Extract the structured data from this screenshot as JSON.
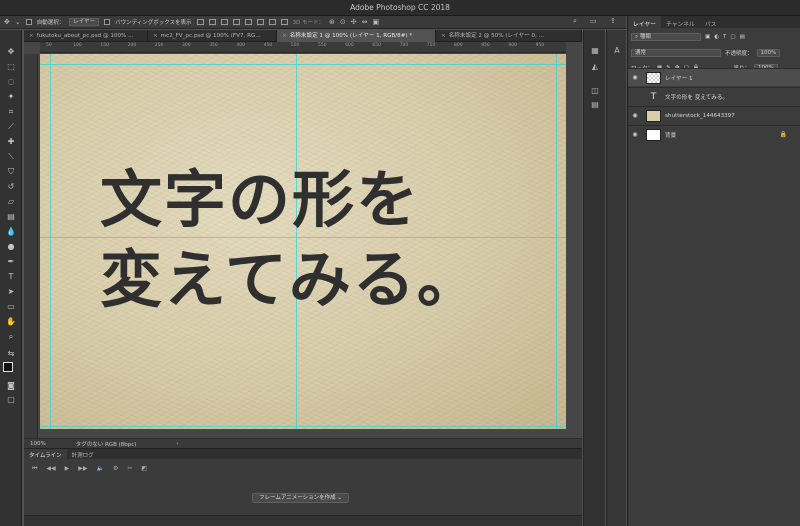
{
  "titlebar": {
    "title": "Adobe Photoshop CC 2018"
  },
  "options_bar": {
    "auto_select_label": "自動選択：",
    "auto_select_value": "レイヤー",
    "bbox_label": "バウンディングボックスを表示",
    "mode_3d_label": "3D モード："
  },
  "tabs": [
    {
      "label": "fukutoku_about_pc.psd @ 100% ..."
    },
    {
      "label": "mc2_FV_pc.psd @ 100% (FV7, RG..."
    },
    {
      "label": "名称未設定 1 @ 100% (レイヤー 1, RGB/8#) *"
    },
    {
      "label": "名称未設定 2 @ 50% (レイヤー 0, ..."
    }
  ],
  "ruler_ticks": [
    "50",
    "100",
    "150",
    "200",
    "250",
    "300",
    "350",
    "400",
    "450",
    "500",
    "550",
    "600",
    "650",
    "700",
    "750",
    "800",
    "850",
    "900",
    "950"
  ],
  "canvas_text": {
    "line1": "文字の形を",
    "line2": "変えてみる。"
  },
  "statusbar": {
    "zoom": "100%",
    "profile": "タグのない RGB (8bpc)"
  },
  "timeline": {
    "tab_timeline": "タイムライン",
    "tab_history": "計測ログ",
    "create_button": "フレームアニメーションを作成"
  },
  "layers_panel": {
    "tabs": [
      "レイヤー",
      "チャンネル",
      "パス"
    ],
    "filter_label": "種類",
    "blend_mode": "通常",
    "opacity_label": "不透明度：",
    "opacity_value": "100%",
    "lock_label": "ロック：",
    "fill_label": "塗り：",
    "fill_value": "100%",
    "layers": [
      {
        "name": "レイヤー 1",
        "selected": true
      },
      {
        "name": "文字の形を 変えてみる。",
        "selected": false
      },
      {
        "name": "shutterstock_144643397",
        "selected": false
      },
      {
        "name": "背景",
        "selected": false
      }
    ]
  },
  "colors": {
    "canvas_paper": "#d7cca9",
    "guide": "#3cd2d2",
    "text": "#2f2f2f"
  }
}
